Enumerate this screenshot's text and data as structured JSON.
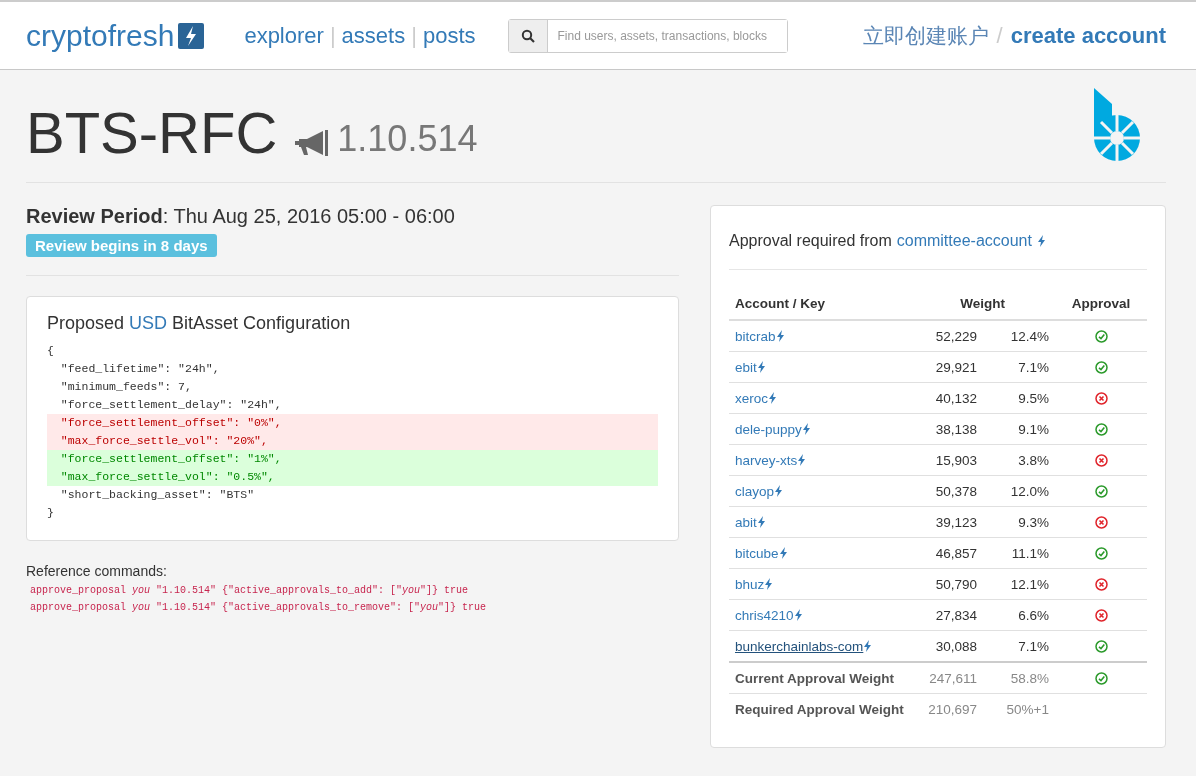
{
  "header": {
    "brand": "cryptofresh",
    "nav": [
      "explorer",
      "assets",
      "posts"
    ],
    "nav_separators": [
      "|",
      "|"
    ],
    "account_separator": "/",
    "search": {
      "placeholder": "Find users, assets, transactions, blocks"
    },
    "signup_cn": "立即创建账户",
    "create_account": "create account"
  },
  "title": "BTS-RFC",
  "proposal_id": "1.10.514",
  "review": {
    "text": "**Review Period**: Thu Aug 25, 2016 05:00 - 06:00",
    "badge": "Review begins in 8 days"
  },
  "config": {
    "title_before": "Proposed",
    "asset": "USD",
    "title_after": "BitAsset Configuration",
    "lines": [
      {
        "text": "{",
        "kind": "plain"
      },
      {
        "text": "  \"feed_lifetime\": \"24h\",",
        "kind": "plain"
      },
      {
        "text": "  \"minimum_feeds\": 7,",
        "kind": "plain"
      },
      {
        "text": "  \"force_settlement_delay\": \"24h\",",
        "kind": "plain"
      },
      {
        "text": "  \"force_settlement_offset\": \"0%\",",
        "kind": "removed"
      },
      {
        "text": "  \"max_force_settle_vol\": \"20%\",",
        "kind": "removed"
      },
      {
        "text": "  \"force_settlement_offset\": \"1%\",",
        "kind": "added"
      },
      {
        "text": "  \"max_force_settle_vol\": \"0.5%\",",
        "kind": "added"
      },
      {
        "text": "  \"short_backing_asset\": \"BTS\"",
        "kind": "plain"
      },
      {
        "text": "}",
        "kind": "plain"
      }
    ]
  },
  "reference": {
    "label": "Reference commands:",
    "commands": [
      "approve_proposal *you* \"1.10.514\" {\"active_approvals_to_add\": [\"*you*\"]} true",
      "approve_proposal *you* \"1.10.514\" {\"active_approvals_to_remove\": [\"*you*\"]} true"
    ]
  },
  "approvals": {
    "heading": "Approval required from",
    "account": "committee-account",
    "columns": [
      "Account / Key",
      "Weight",
      "Approval"
    ],
    "rows": [
      {
        "account": "bitcrab",
        "weight": "52,229",
        "percent": "12.4%",
        "approved": true,
        "hovered": false
      },
      {
        "account": "ebit",
        "weight": "29,921",
        "percent": "7.1%",
        "approved": true,
        "hovered": false
      },
      {
        "account": "xeroc",
        "weight": "40,132",
        "percent": "9.5%",
        "approved": false,
        "hovered": false
      },
      {
        "account": "dele-puppy",
        "weight": "38,138",
        "percent": "9.1%",
        "approved": true,
        "hovered": false
      },
      {
        "account": "harvey-xts",
        "weight": "15,903",
        "percent": "3.8%",
        "approved": false,
        "hovered": false
      },
      {
        "account": "clayop",
        "weight": "50,378",
        "percent": "12.0%",
        "approved": true,
        "hovered": false
      },
      {
        "account": "abit",
        "weight": "39,123",
        "percent": "9.3%",
        "approved": false,
        "hovered": false
      },
      {
        "account": "bitcube",
        "weight": "46,857",
        "percent": "11.1%",
        "approved": true,
        "hovered": false
      },
      {
        "account": "bhuz",
        "weight": "50,790",
        "percent": "12.1%",
        "approved": false,
        "hovered": false
      },
      {
        "account": "chris4210",
        "weight": "27,834",
        "percent": "6.6%",
        "approved": false,
        "hovered": false
      },
      {
        "account": "bunkerchainlabs-com",
        "weight": "30,088",
        "percent": "7.1%",
        "approved": true,
        "hovered": true
      }
    ],
    "totals": [
      {
        "label": "Current Approval Weight",
        "weight": "247,611",
        "percent": "58.8%",
        "approved": true
      },
      {
        "label": "Required Approval Weight",
        "weight": "210,697",
        "percent": "50%+1"
      }
    ]
  }
}
